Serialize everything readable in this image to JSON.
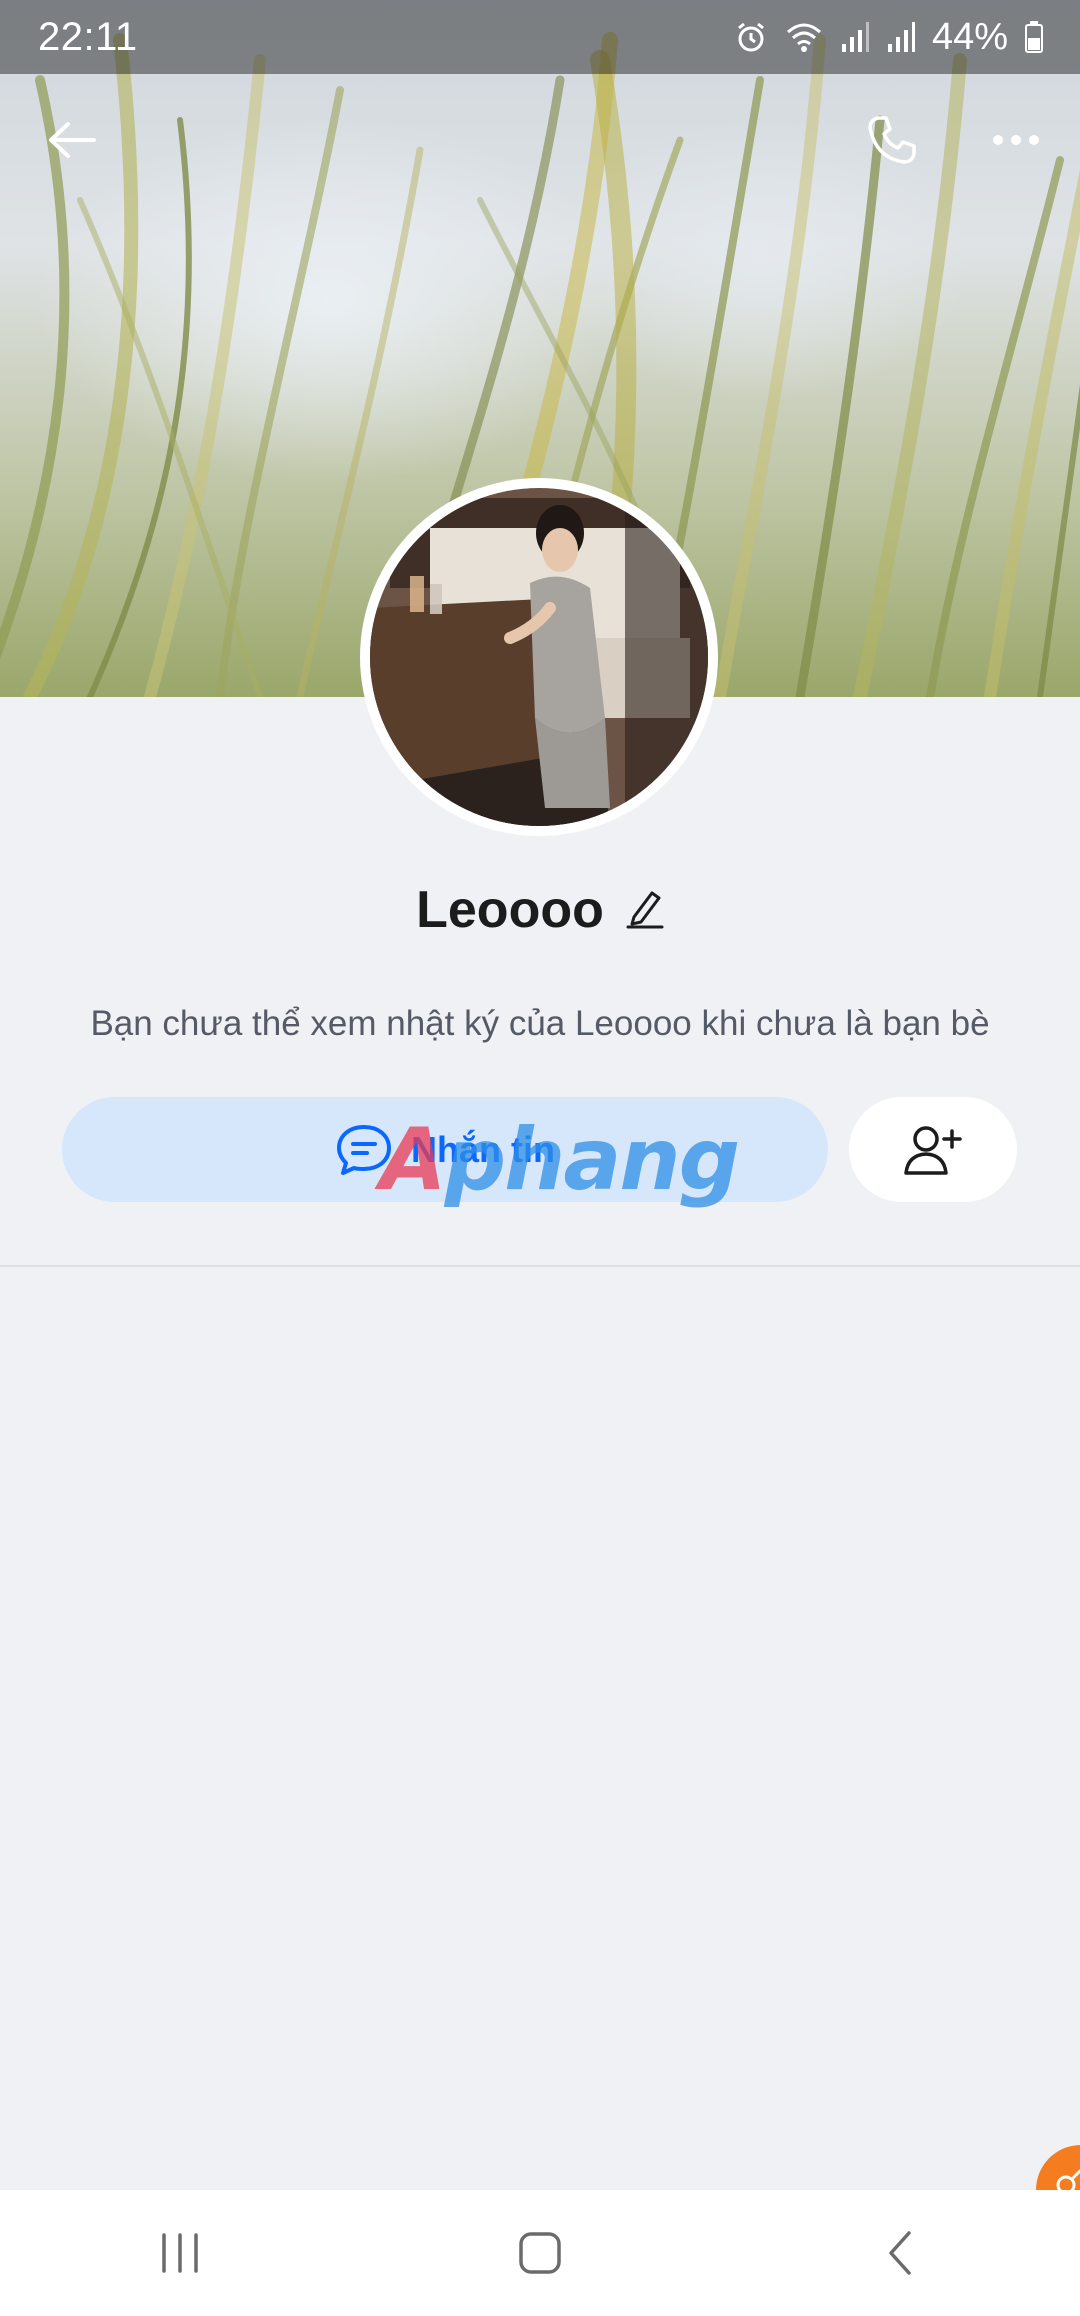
{
  "status_bar": {
    "time": "22:11",
    "battery": "44%",
    "icons": [
      "alarm-icon",
      "wifi-icon",
      "signal-icon",
      "signal-icon",
      "battery-icon"
    ]
  },
  "header": {
    "icons": [
      "back-arrow-icon",
      "phone-icon",
      "more-icon"
    ]
  },
  "profile": {
    "name": "Leoooo",
    "notice": "Bạn chưa thể xem nhật ký của Leoooo khi chưa là bạn bè"
  },
  "actions": {
    "message_label": "Nhắn tin",
    "message_icon": "chat-bubble-icon",
    "add_friend_icon": "add-user-icon"
  },
  "watermark": {
    "first": "A",
    "rest": "phang"
  },
  "navbar": {
    "icons": [
      "recent-apps-icon",
      "home-icon",
      "back-icon"
    ]
  },
  "colors": {
    "accent": "#0a68ff",
    "message_button_bg": "#d7e7fb",
    "page_bg": "#f0f1f5",
    "floating_button": "#f57c1f"
  }
}
